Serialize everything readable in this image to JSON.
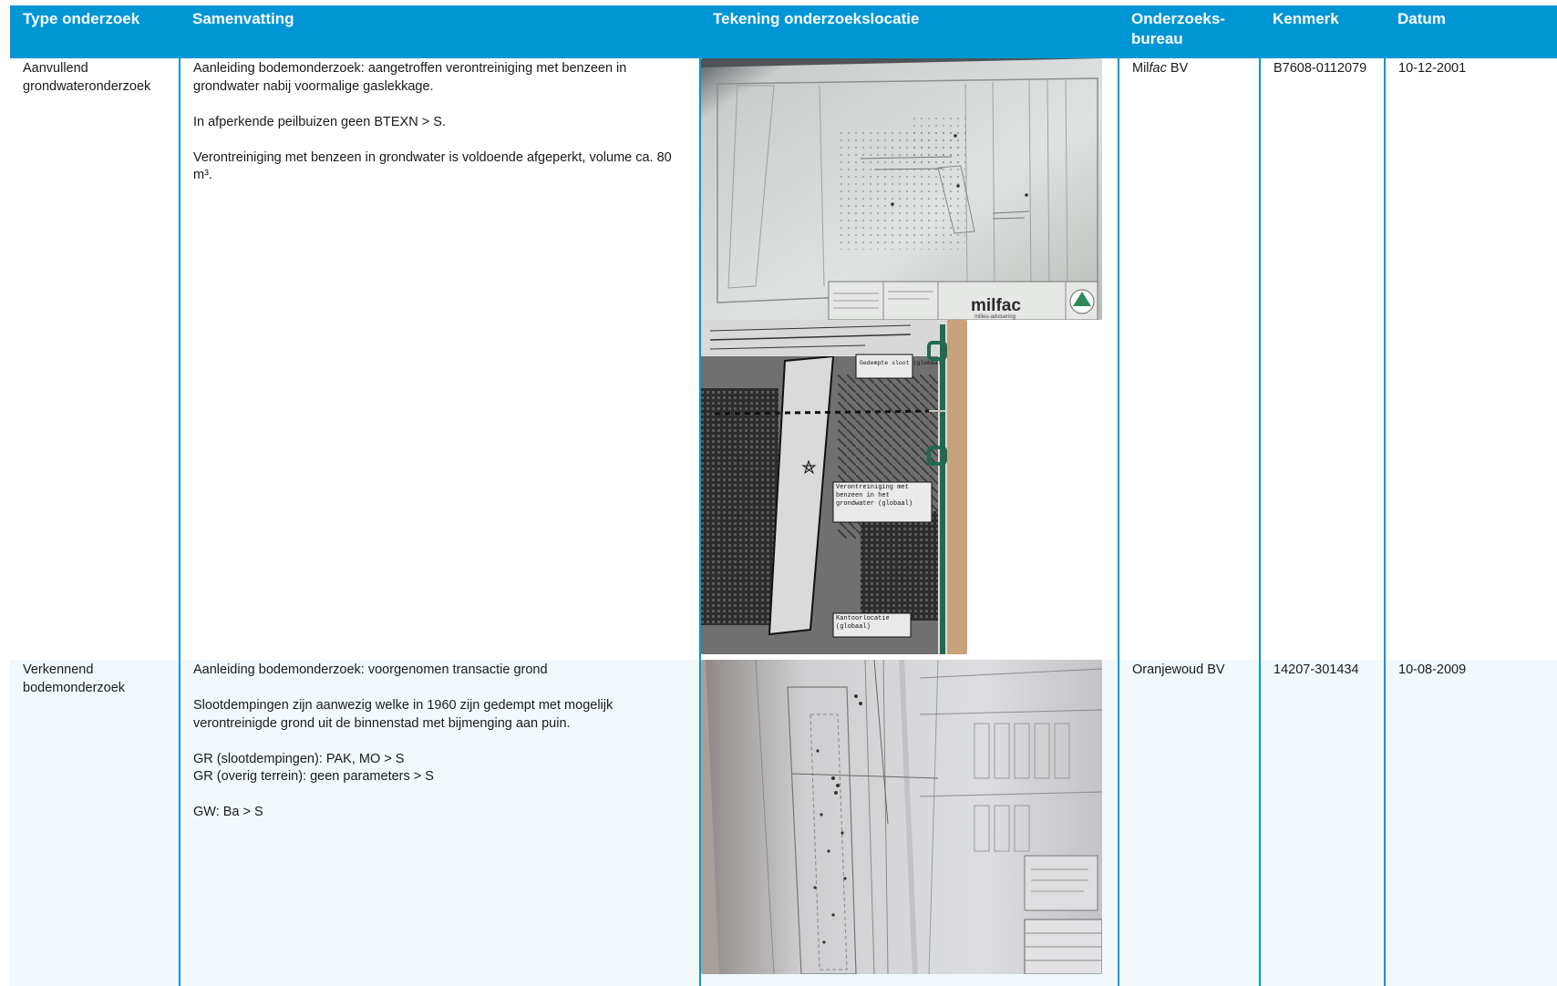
{
  "table": {
    "headers": {
      "type": "Type onderzoek",
      "summary": "Samenvatting",
      "drawing": "Tekening onderzoekslocatie",
      "bureau_line1": "Onderzoeks-",
      "bureau_line2": "bureau",
      "reference": "Kenmerk",
      "date": "Datum"
    },
    "rows": [
      {
        "type": "Aanvullend grondwateronderzoek",
        "summary": [
          "Aanleiding bodemonderzoek: aangetroffen verontreiniging met benzeen in grondwater  nabij voormalige gaslekkage.",
          "In afperkende peilbuizen geen BTEXN > S.",
          "Verontreiniging met benzeen in grondwater is voldoende afgeperkt, volume ca. 80 m³."
        ],
        "bureau_prefix": "Mil",
        "bureau_italic": "fac",
        "bureau_suffix": " BV",
        "reference": "B7608-0112079",
        "date": "10-12-2001",
        "images": [
          {
            "name": "site-map-photo-milfac",
            "logo": "milfac",
            "logo_sub": "milieu-advisering"
          },
          {
            "name": "aerial-photo-contamination",
            "labels": [
              "Verontreiniging met benzeen in het grondwater (globaal)",
              "Kantoorlocatie (globaal)",
              "Gedempte sloot (globaal)"
            ]
          }
        ]
      },
      {
        "type": "Verkennend bodemonderzoek",
        "summary": [
          "Aanleiding bodemonderzoek: voorgenomen transactie grond",
          "Slootdempingen zijn aanwezig welke in 1960 zijn gedempt met mogelijk verontreinigde grond uit de binnenstad met bijmenging aan puin.",
          "GR (slootdempingen): PAK, MO > S\nGR (overig terrein): geen parameters > S",
          "GW: Ba > S"
        ],
        "bureau": "Oranjewoud BV",
        "reference": "14207-301434",
        "date": "10-08-2009",
        "images": [
          {
            "name": "site-map-photo-oranjewoud"
          }
        ]
      }
    ]
  },
  "colors": {
    "header_bg": "#0096d6",
    "row_alt_bg": "#f2f9fc",
    "logo_green": "#2e8b57"
  }
}
